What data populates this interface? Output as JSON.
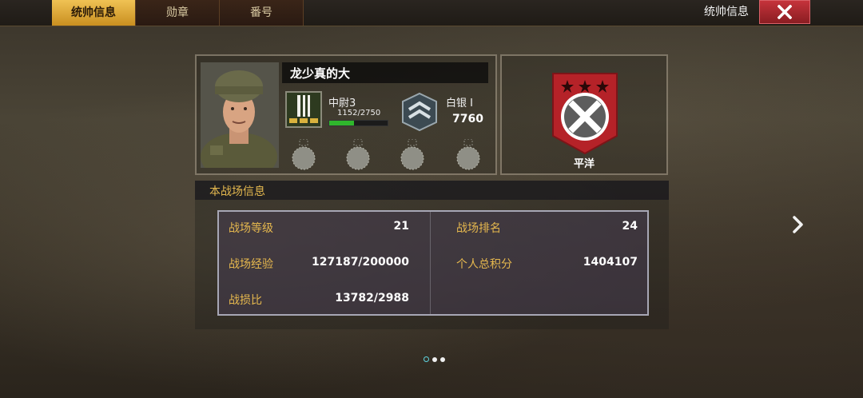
{
  "tabs": [
    {
      "label": "统帅信息",
      "active": true
    },
    {
      "label": "勋章",
      "active": false
    },
    {
      "label": "番号",
      "active": false
    }
  ],
  "header": {
    "title": "统帅信息",
    "close_icon": "close-icon"
  },
  "commander": {
    "name": "龙少真的大",
    "rank": {
      "name": "中尉3",
      "xp": "1152/2750",
      "progress": 0.42
    },
    "league": {
      "name": "白银 I",
      "score": "7760"
    },
    "medal_slots": 4
  },
  "result": {
    "label": "平洋",
    "stars": 3,
    "colors": {
      "badge": "#c92a2a",
      "star": "#2a0808"
    }
  },
  "battle_info": {
    "title": "本战场信息",
    "stats": [
      {
        "label": "战场等级",
        "value": "21"
      },
      {
        "label": "战场排名",
        "value": "24"
      },
      {
        "label": "战场经验",
        "value": "127187/200000"
      },
      {
        "label": "个人总积分",
        "value": "1404107"
      },
      {
        "label": "战损比",
        "value": "13782/2988"
      }
    ]
  },
  "pagination": {
    "count": 3,
    "current": 0
  },
  "colors": {
    "accent": "#e6b84e",
    "tab_active": "#e5b13b",
    "close": "#b52a31"
  }
}
